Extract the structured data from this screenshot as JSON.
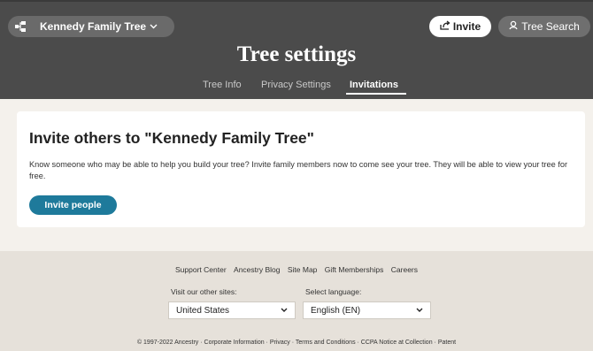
{
  "header": {
    "tree_name": "Kennedy Family Tree",
    "invite_label": "Invite",
    "tree_search_label": "Tree Search",
    "page_title": "Tree settings",
    "tabs": [
      {
        "label": "Tree Info",
        "active": false
      },
      {
        "label": "Privacy Settings",
        "active": false
      },
      {
        "label": "Invitations",
        "active": true
      }
    ]
  },
  "main": {
    "heading": "Invite others to \"Kennedy Family Tree\"",
    "description": "Know someone who may be able to help you build your tree? Invite family members now to come see your tree. They will be able to view your tree for free.",
    "invite_people_label": "Invite people"
  },
  "footer": {
    "links": [
      "Support Center",
      "Ancestry Blog",
      "Site Map",
      "Gift Memberships",
      "Careers"
    ],
    "other_sites_label": "Visit our other sites:",
    "other_sites_value": "United States",
    "language_label": "Select language:",
    "language_value": "English (EN)",
    "copyright": "© 1997-2022 Ancestry · Corporate Information · Privacy · Terms and Conditions · CCPA Notice at Collection · Patent"
  },
  "colors": {
    "header_bg": "#4b4b4b",
    "accent": "#1e7a9b",
    "page_bg": "#f4f1ec",
    "footer_bg": "#e6e1da"
  },
  "icons": {
    "tree": "tree-icon",
    "dropdown": "chevron-down-icon",
    "invite": "share-icon",
    "search": "person-search-icon"
  }
}
